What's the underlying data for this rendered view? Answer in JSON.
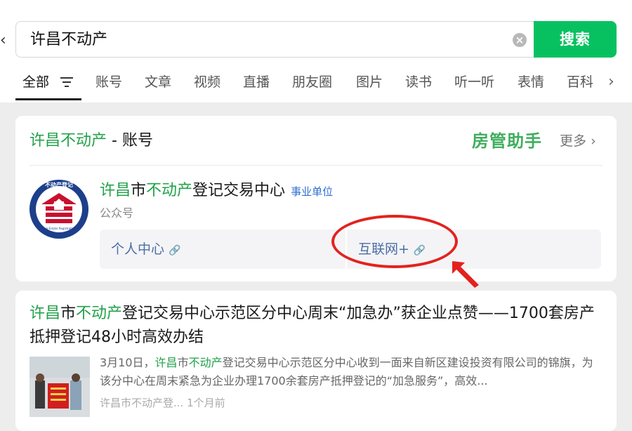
{
  "search": {
    "query": "许昌不动产",
    "button_label": "搜索"
  },
  "tabs": [
    {
      "label": "全部"
    },
    {
      "label": "账号"
    },
    {
      "label": "文章"
    },
    {
      "label": "视频"
    },
    {
      "label": "直播"
    },
    {
      "label": "朋友圈"
    },
    {
      "label": "图片"
    },
    {
      "label": "读书"
    },
    {
      "label": "听一听"
    },
    {
      "label": "表情"
    },
    {
      "label": "百科"
    }
  ],
  "account_card": {
    "header_keyword": "许昌不动产",
    "header_suffix": " - 账号",
    "helper_text": "房管助手",
    "more_label": "更多",
    "account": {
      "name_parts": [
        "许昌",
        "市",
        "不动产",
        "登记交易中心"
      ],
      "badge": "事业单位",
      "type": "公众号",
      "logo_top_text": "不动产登记",
      "logo_bottom_text": "Real Estate Registration"
    },
    "services": [
      {
        "label": "个人中心"
      },
      {
        "label": "互联网+"
      }
    ]
  },
  "article": {
    "title_parts": [
      "许昌",
      "市",
      "不动产",
      "登记交易中心示范区分中心周末“加急办”获企业点赞——1700套房产抵押登记48小时高效办结"
    ],
    "summary_parts": [
      "3月10日，",
      "许昌",
      "市",
      "不动产",
      "登记交易中心示范区分中心收到一面来自新区建设投资有限公司的锦旗，为该分中心在周末紧急为企业办理1700余套房产抵押登记的“加急服务”，高效..."
    ],
    "source": "许昌市不动产登...",
    "time": "1个月前"
  },
  "colors": {
    "accent": "#07c160",
    "highlight": "#21a14a",
    "annotation": "#e3221e",
    "link": "#4b6ea5"
  }
}
